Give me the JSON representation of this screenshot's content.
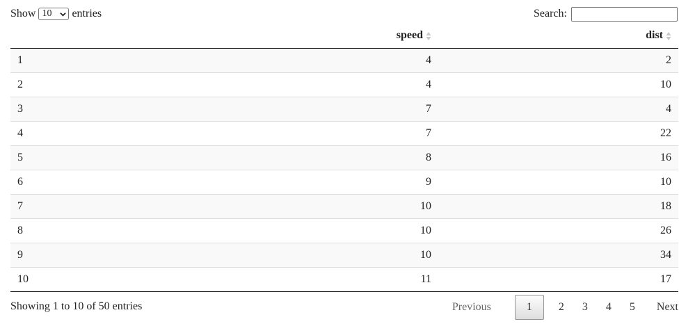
{
  "controls": {
    "show_label": "Show",
    "page_length": "10",
    "entries_label": "entries",
    "search_label": "Search:",
    "search_value": ""
  },
  "table": {
    "columns": [
      "",
      "speed",
      "dist"
    ],
    "rows": [
      [
        "1",
        "4",
        "2"
      ],
      [
        "2",
        "4",
        "10"
      ],
      [
        "3",
        "7",
        "4"
      ],
      [
        "4",
        "7",
        "22"
      ],
      [
        "5",
        "8",
        "16"
      ],
      [
        "6",
        "9",
        "10"
      ],
      [
        "7",
        "10",
        "18"
      ],
      [
        "8",
        "10",
        "26"
      ],
      [
        "9",
        "10",
        "34"
      ],
      [
        "10",
        "11",
        "17"
      ]
    ]
  },
  "footer": {
    "info": "Showing 1 to 10 of 50 entries",
    "previous_label": "Previous",
    "pages": [
      "1",
      "2",
      "3",
      "4",
      "5"
    ],
    "next_label": "Next"
  },
  "colors": {
    "stripe": "#f9f9f9",
    "sort_icon": "#c8c8c8"
  }
}
